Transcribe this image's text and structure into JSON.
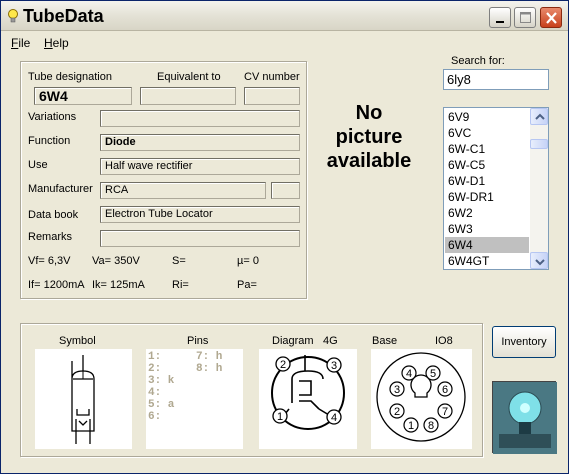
{
  "window": {
    "title": "TubeData"
  },
  "menu": {
    "file": "File",
    "file_underline": "F",
    "file_rest": "ile",
    "help": "Help",
    "help_underline": "H",
    "help_rest": "elp"
  },
  "main": {
    "header_designation": "Tube designation",
    "header_equivalent": "Equivalent to",
    "header_cv": "CV number",
    "designation": "6W4",
    "equivalent": "",
    "cv_number": "",
    "labels": {
      "variations": "Variations",
      "function": "Function",
      "use": "Use",
      "manufacturer": "Manufacturer",
      "data_book": "Data book",
      "remarks": "Remarks"
    },
    "values": {
      "variations": "",
      "function": "Diode",
      "use": "Half wave rectifier",
      "manufacturer": "RCA",
      "manufacturer_extra": "",
      "data_book": "Electron Tube Locator",
      "remarks": ""
    },
    "params_row1": {
      "vf": "Vf= 6,3V",
      "va": "Va=  350V",
      "s": "S=",
      "mu": "µ=    0"
    },
    "params_row2": {
      "if": "If= 1200mA",
      "ik": "Ik=   125mA",
      "ri": "Ri=",
      "pa": "Pa="
    }
  },
  "picture": {
    "line1": "No",
    "line2": "picture",
    "line3": "available"
  },
  "search": {
    "label": "Search for:",
    "value": "6ly8"
  },
  "tube_list": {
    "items": [
      "6V9",
      "6VC",
      "6W-C1",
      "6W-C5",
      "6W-D1",
      "6W-DR1",
      "6W2",
      "6W3",
      "6W4",
      "6W4GT"
    ],
    "selected": "6W4"
  },
  "bottom": {
    "symbol_label": "Symbol",
    "pins_label": "Pins",
    "diagram_label": "Diagram",
    "diagram_code": "4G",
    "base_label": "Base",
    "base_code": "IO8",
    "pins": [
      {
        "left": "1:",
        "right": "7: h"
      },
      {
        "left": "2:",
        "right": "8: h"
      },
      {
        "left": "3: k",
        "right": ""
      },
      {
        "left": "4:",
        "right": ""
      },
      {
        "left": "5: a",
        "right": ""
      },
      {
        "left": "6:",
        "right": ""
      }
    ],
    "diagram_pins": [
      "2",
      "3",
      "1",
      "4"
    ],
    "base_pins": [
      "4",
      "5",
      "3",
      "6",
      "2",
      "7",
      "1",
      "8"
    ]
  },
  "buttons": {
    "inventory": "Inventory"
  },
  "colors": {
    "selection": "#c0c0c0",
    "title_bg": "#e4e2d6",
    "close": "#c8401c",
    "pins_text": "#b0a890"
  }
}
